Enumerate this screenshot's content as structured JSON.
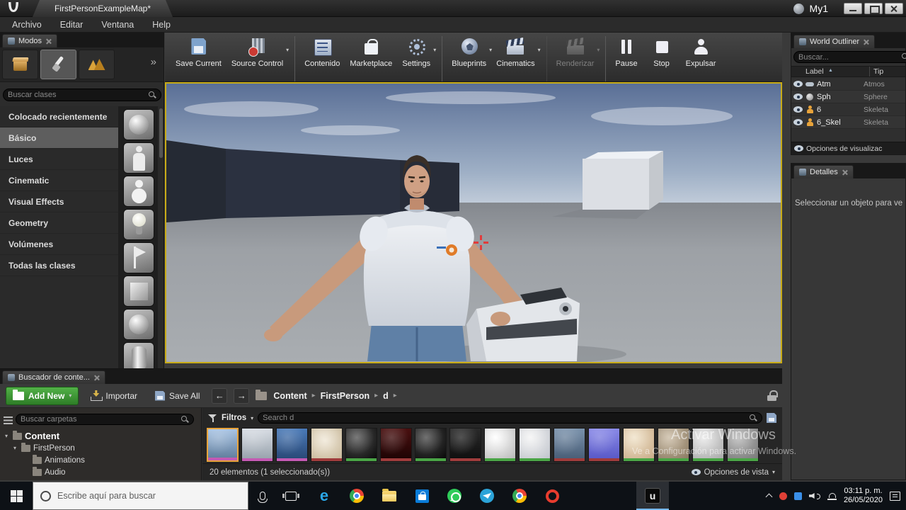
{
  "ui": {
    "close": "×",
    "caret": "▾",
    "crumb_sep": "▸",
    "back": "←",
    "forward": "→",
    "more": "»",
    "sort_asc": "▲"
  },
  "colors": {
    "viewport_border": "#c8ab16",
    "selection_orange": "#e8a33a",
    "add_new_green": "linear-gradient(180deg,#52b147,#2e7d27)",
    "crosshair_red": "#e03c3c"
  },
  "title_bar": {
    "tab_title": "FirstPersonExampleMap*",
    "project_name": "My1"
  },
  "menu_bar": {
    "items": [
      "Archivo",
      "Editar",
      "Ventana",
      "Help"
    ]
  },
  "main_toolbar": {
    "buttons": [
      {
        "label": "Save Current",
        "icon": "save-icon",
        "caret": "",
        "cls": "enabled"
      },
      {
        "label": "Source Control",
        "icon": "source-control-icon",
        "caret": "▾",
        "cls": "enabled"
      },
      {
        "label": "Contenido",
        "icon": "content-icon",
        "caret": "",
        "cls": "enabled group-sep"
      },
      {
        "label": "Marketplace",
        "icon": "marketplace-icon",
        "caret": "",
        "cls": "enabled"
      },
      {
        "label": "Settings",
        "icon": "settings-icon",
        "caret": "▾",
        "cls": "enabled"
      },
      {
        "label": "Blueprints",
        "icon": "blueprints-icon",
        "caret": "▾",
        "cls": "enabled group-sep"
      },
      {
        "label": "Cinematics",
        "icon": "cinematics-icon",
        "caret": "▾",
        "cls": "enabled"
      },
      {
        "label": "Renderizar",
        "icon": "render-icon",
        "caret": "▾",
        "cls": "disabled group-sep"
      },
      {
        "label": "Pause",
        "icon": "pause-icon",
        "caret": "",
        "cls": "enabled group-sep"
      },
      {
        "label": "Stop",
        "icon": "stop-icon",
        "caret": "",
        "cls": "enabled"
      },
      {
        "label": "Expulsar",
        "icon": "eject-icon",
        "caret": "",
        "cls": "enabled"
      }
    ]
  },
  "modes_panel": {
    "tab_label": "Modos",
    "search_placeholder": "Buscar clases",
    "categories": [
      {
        "label": "Colocado recientemente",
        "cls": ""
      },
      {
        "label": "Básico",
        "cls": "selected"
      },
      {
        "label": "Luces",
        "cls": ""
      },
      {
        "label": "Cinematic",
        "cls": ""
      },
      {
        "label": "Visual Effects",
        "cls": ""
      },
      {
        "label": "Geometry",
        "cls": ""
      },
      {
        "label": "Volúmenes",
        "cls": ""
      },
      {
        "label": "Todas las clases",
        "cls": ""
      }
    ],
    "thumbs": [
      {
        "name": "empty-actor-thumb",
        "shape": "sphere-shape"
      },
      {
        "name": "empty-character-thumb",
        "shape": "mannequin-shape"
      },
      {
        "name": "empty-pawn-thumb",
        "shape": "figure-shape"
      },
      {
        "name": "point-light-thumb",
        "shape": "bulb-shape"
      },
      {
        "name": "player-start-thumb",
        "shape": "flag-shape"
      },
      {
        "name": "cube-thumb",
        "shape": "cube-shape"
      },
      {
        "name": "sphere-thumb",
        "shape": "sphere-shape"
      },
      {
        "name": "cylinder-thumb",
        "shape": "cylinder-shape"
      }
    ]
  },
  "world_outliner": {
    "tab_label": "World Outliner",
    "search_placeholder": "Buscar...",
    "col_label": "Label",
    "col_type": "Tip",
    "rows": [
      {
        "icon": "fog-actor-icon",
        "label": "Atm",
        "type": "Atmos"
      },
      {
        "icon": "sphere-actor-icon",
        "label": "Sph",
        "type": "Sphere"
      },
      {
        "icon": "skeletal-actor-icon",
        "label": "6",
        "type": "Skeleta"
      },
      {
        "icon": "skeletal-actor-icon",
        "label": "6_Skel",
        "type": "Skeleta"
      }
    ],
    "footer": "Opciones de visualizac"
  },
  "details_panel": {
    "tab_label": "Detalles",
    "empty_text": "Seleccionar un objeto para ve"
  },
  "content_browser": {
    "tab_label": "Buscador de conte...",
    "add_new_label": "Add New",
    "import_label": "Importar",
    "save_all_label": "Save All",
    "breadcrumbs": [
      {
        "label": "Content",
        "sep": "▸"
      },
      {
        "label": "FirstPerson",
        "sep": "▸"
      },
      {
        "label": "d",
        "sep": "▸"
      }
    ],
    "folder_search_placeholder": "Buscar carpetas",
    "tree": [
      {
        "label": "Content",
        "expander": "▾",
        "cls": "depth-0 root"
      },
      {
        "label": "FirstPerson",
        "expander": "▾",
        "cls": "depth-1"
      },
      {
        "label": "Animations",
        "expander": "",
        "cls": "depth-2"
      },
      {
        "label": "Audio",
        "expander": "",
        "cls": "depth-2"
      }
    ],
    "filters_label": "Filtros",
    "asset_search_placeholder": "Search d",
    "assets": [
      {
        "kind": "character-asset",
        "bg": "linear-gradient(180deg,#a8c4e4,#63809f)",
        "strip": "#c45ab3",
        "cls": "selected"
      },
      {
        "kind": "character-asset",
        "bg": "linear-gradient(180deg,#d8dde4,#9aa4ae)",
        "strip": "#c45ab3",
        "cls": ""
      },
      {
        "kind": "skeleton-asset",
        "bg": "linear-gradient(180deg,#4a7ab8,#2a4a78)",
        "strip": "#c45ab3",
        "cls": ""
      },
      {
        "kind": "texture-asset",
        "bg": "radial-gradient(circle at 45% 40%,#f0e8d8,#c8b89a)",
        "strip": "#a03c3c",
        "cls": ""
      },
      {
        "kind": "material-asset",
        "bg": "radial-gradient(circle at 35% 30%,#555555,#0a0a0a)",
        "strip": "#4aa546",
        "cls": ""
      },
      {
        "kind": "texture-asset",
        "bg": "linear-gradient(180deg,#4a1010,#200404)",
        "strip": "#a03c3c",
        "cls": ""
      },
      {
        "kind": "material-asset",
        "bg": "radial-gradient(circle at 35% 30%,#4a4a4a,#080808)",
        "strip": "#4aa546",
        "cls": ""
      },
      {
        "kind": "texture-asset",
        "bg": "linear-gradient(180deg,#2a2a2a,#101010)",
        "strip": "#a03c3c",
        "cls": ""
      },
      {
        "kind": "material-asset",
        "bg": "radial-gradient(circle at 35% 30%,#ffffff,#b8b8b8)",
        "strip": "#4aa546",
        "cls": ""
      },
      {
        "kind": "material-asset",
        "bg": "radial-gradient(circle at 35% 30%,#f4f4f4,#c0c4cc)",
        "strip": "#4aa546",
        "cls": ""
      },
      {
        "kind": "texture-asset",
        "bg": "linear-gradient(180deg,#7a92ac,#4a5f78)",
        "strip": "#a03c3c",
        "cls": ""
      },
      {
        "kind": "texture-asset",
        "bg": "linear-gradient(180deg,#8a8ae8,#5a5ac8)",
        "strip": "#a03c3c",
        "cls": ""
      },
      {
        "kind": "material-asset",
        "bg": "radial-gradient(circle at 35% 30%,#f0e2c8,#c8ab88)",
        "strip": "#4aa546",
        "cls": ""
      },
      {
        "kind": "material-asset",
        "bg": "radial-gradient(circle at 35% 30%,#cabba4,#8a7a62)",
        "strip": "#4aa546",
        "cls": ""
      },
      {
        "kind": "material-asset",
        "bg": "radial-gradient(circle at 35% 30%,#e8e8e8,#a8a8a8)",
        "strip": "#4aa546",
        "cls": ""
      },
      {
        "kind": "material-asset",
        "bg": "radial-gradient(circle at 35% 30%,#b8b8b8,#787878)",
        "strip": "#4aa546",
        "cls": ""
      }
    ],
    "status_left": "20 elementos (1 seleccionado(s))",
    "view_options_label": "Opciones de vista"
  },
  "taskbar": {
    "search_placeholder": "Escribe aquí para buscar",
    "apps": [
      {
        "name": "edge-icon",
        "glyph": "e",
        "cls": ""
      },
      {
        "name": "chrome-icon",
        "glyph": "",
        "cls": ""
      },
      {
        "name": "file-explorer-icon",
        "glyph": "",
        "cls": ""
      },
      {
        "name": "store-icon",
        "glyph": "",
        "cls": ""
      },
      {
        "name": "whatsapp-icon",
        "glyph": "",
        "cls": ""
      },
      {
        "name": "telegram-icon",
        "glyph": "",
        "cls": ""
      },
      {
        "name": "chrome2-icon",
        "glyph": "",
        "cls": ""
      },
      {
        "name": "opera-icon",
        "glyph": "",
        "cls": ""
      },
      {
        "name": "unreal-icon",
        "glyph": "u",
        "cls": "active"
      }
    ],
    "clock_time": "03:11 p. m.",
    "clock_date": "26/05/2020"
  },
  "watermark": {
    "line1": "Activar Windows",
    "line2": "Ve a Configuración para activar Windows."
  }
}
